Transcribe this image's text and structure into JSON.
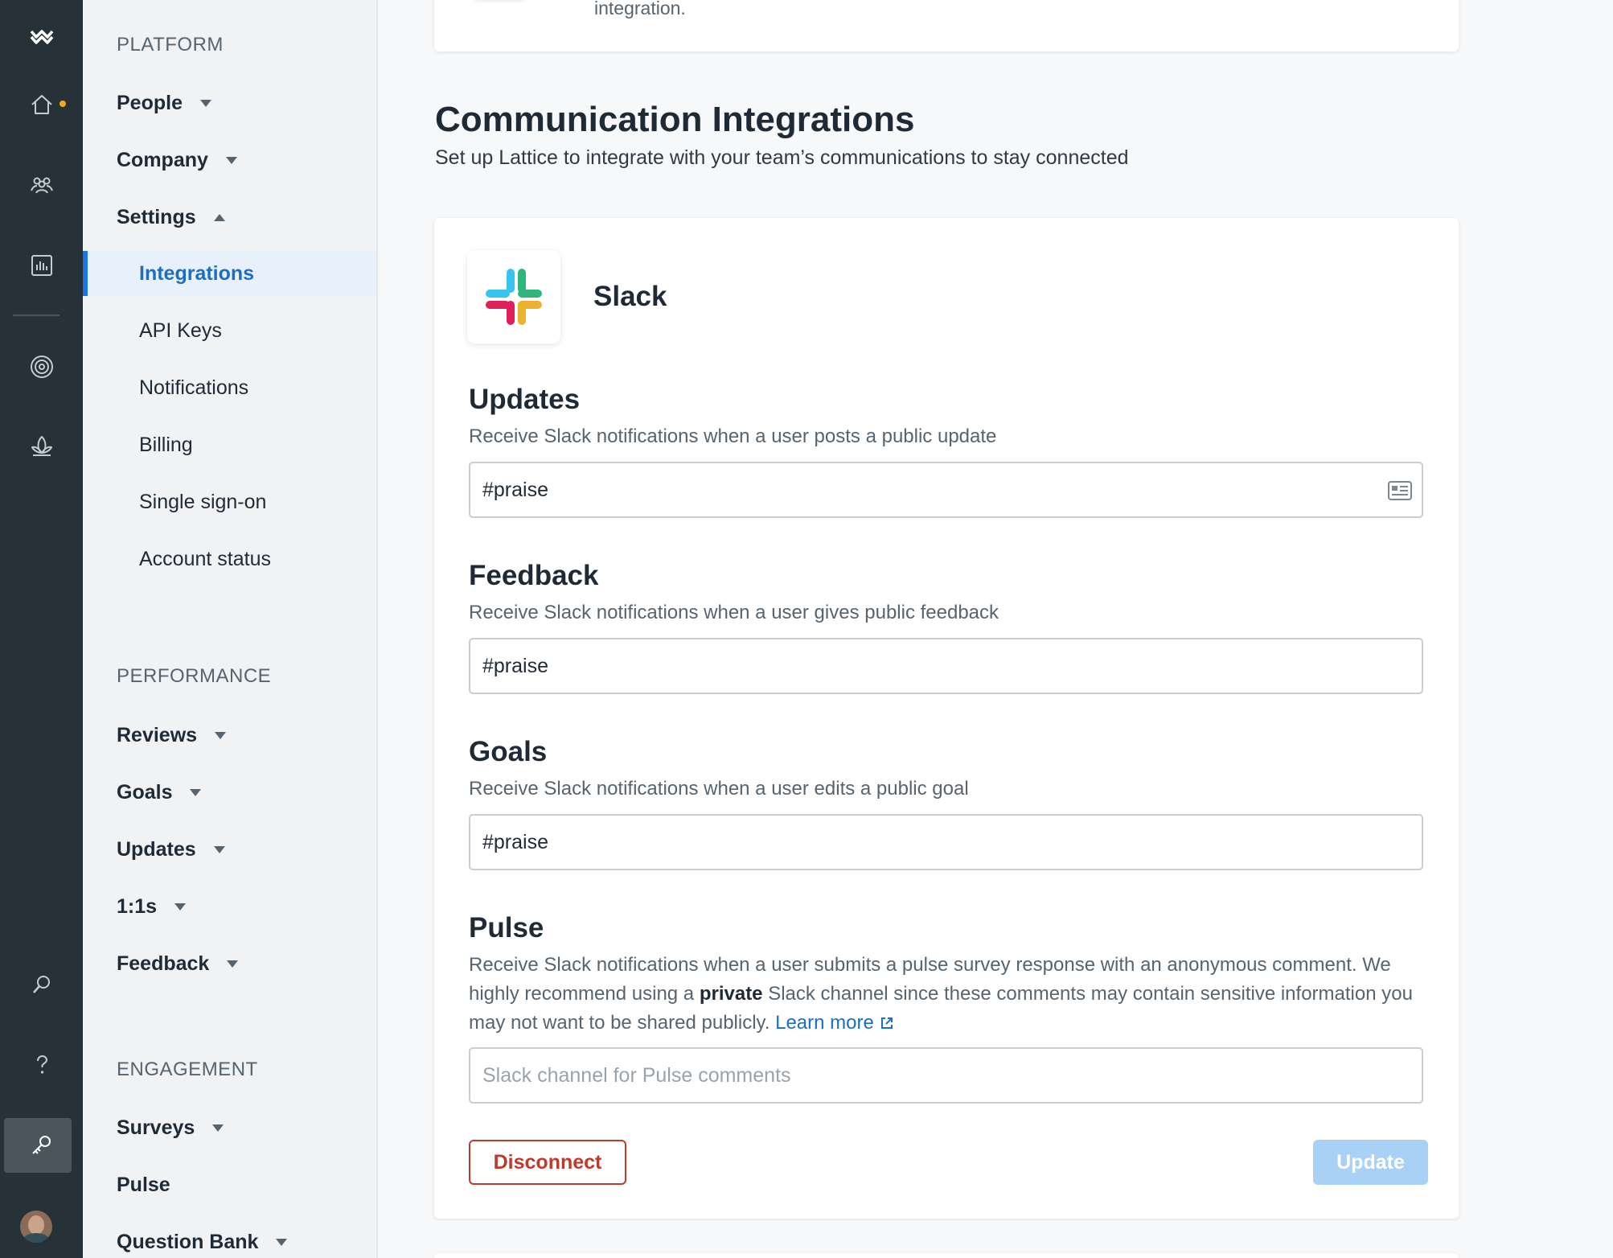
{
  "rail": {
    "items": [
      {
        "name": "logo-icon"
      },
      {
        "name": "home-icon"
      },
      {
        "name": "people-icon"
      },
      {
        "name": "analytics-icon"
      },
      {
        "name": "target-icon"
      },
      {
        "name": "growth-icon"
      },
      {
        "name": "search-icon"
      },
      {
        "name": "help-icon"
      },
      {
        "name": "key-icon"
      }
    ],
    "notification_color": "#f5a623"
  },
  "nav": {
    "platform_label": "PLATFORM",
    "platform_items": [
      "People",
      "Company",
      "Settings"
    ],
    "settings_sub": [
      "Integrations",
      "API Keys",
      "Notifications",
      "Billing",
      "Single sign-on",
      "Account status"
    ],
    "performance_label": "PERFORMANCE",
    "performance_items": [
      "Reviews",
      "Goals",
      "Updates",
      "1:1s",
      "Feedback"
    ],
    "engagement_label": "ENGAGEMENT",
    "engagement_items": [
      "Surveys",
      "Pulse",
      "Question Bank"
    ]
  },
  "main": {
    "top_card_text": "integration.",
    "section_title": "Communication Integrations",
    "section_subtitle": "Set up Lattice to integrate with your team’s communications to stay connected",
    "service_name": "Slack",
    "fields": {
      "updates": {
        "title": "Updates",
        "description": "Receive Slack notifications when a user posts a public update",
        "value": "#praise"
      },
      "feedback": {
        "title": "Feedback",
        "description": "Receive Slack notifications when a user gives public feedback",
        "value": "#praise"
      },
      "goals": {
        "title": "Goals",
        "description": "Receive Slack notifications when a user edits a public goal",
        "value": "#praise"
      },
      "pulse": {
        "title": "Pulse",
        "description_part1": "Receive Slack notifications when a user submits a pulse survey response with an anonymous comment. We highly recommend using a ",
        "description_bold": "private",
        "description_part2": " Slack channel since these comments may contain sensitive information you may not want to be shared publicly. ",
        "learn_more": "Learn more",
        "value": "",
        "placeholder": "Slack channel for Pulse comments"
      }
    },
    "disconnect_label": "Disconnect",
    "update_label": "Update",
    "colors": {
      "accent": "#1a6fc4",
      "danger": "#c0392b",
      "update_disabled": "#a8d1f5"
    }
  }
}
